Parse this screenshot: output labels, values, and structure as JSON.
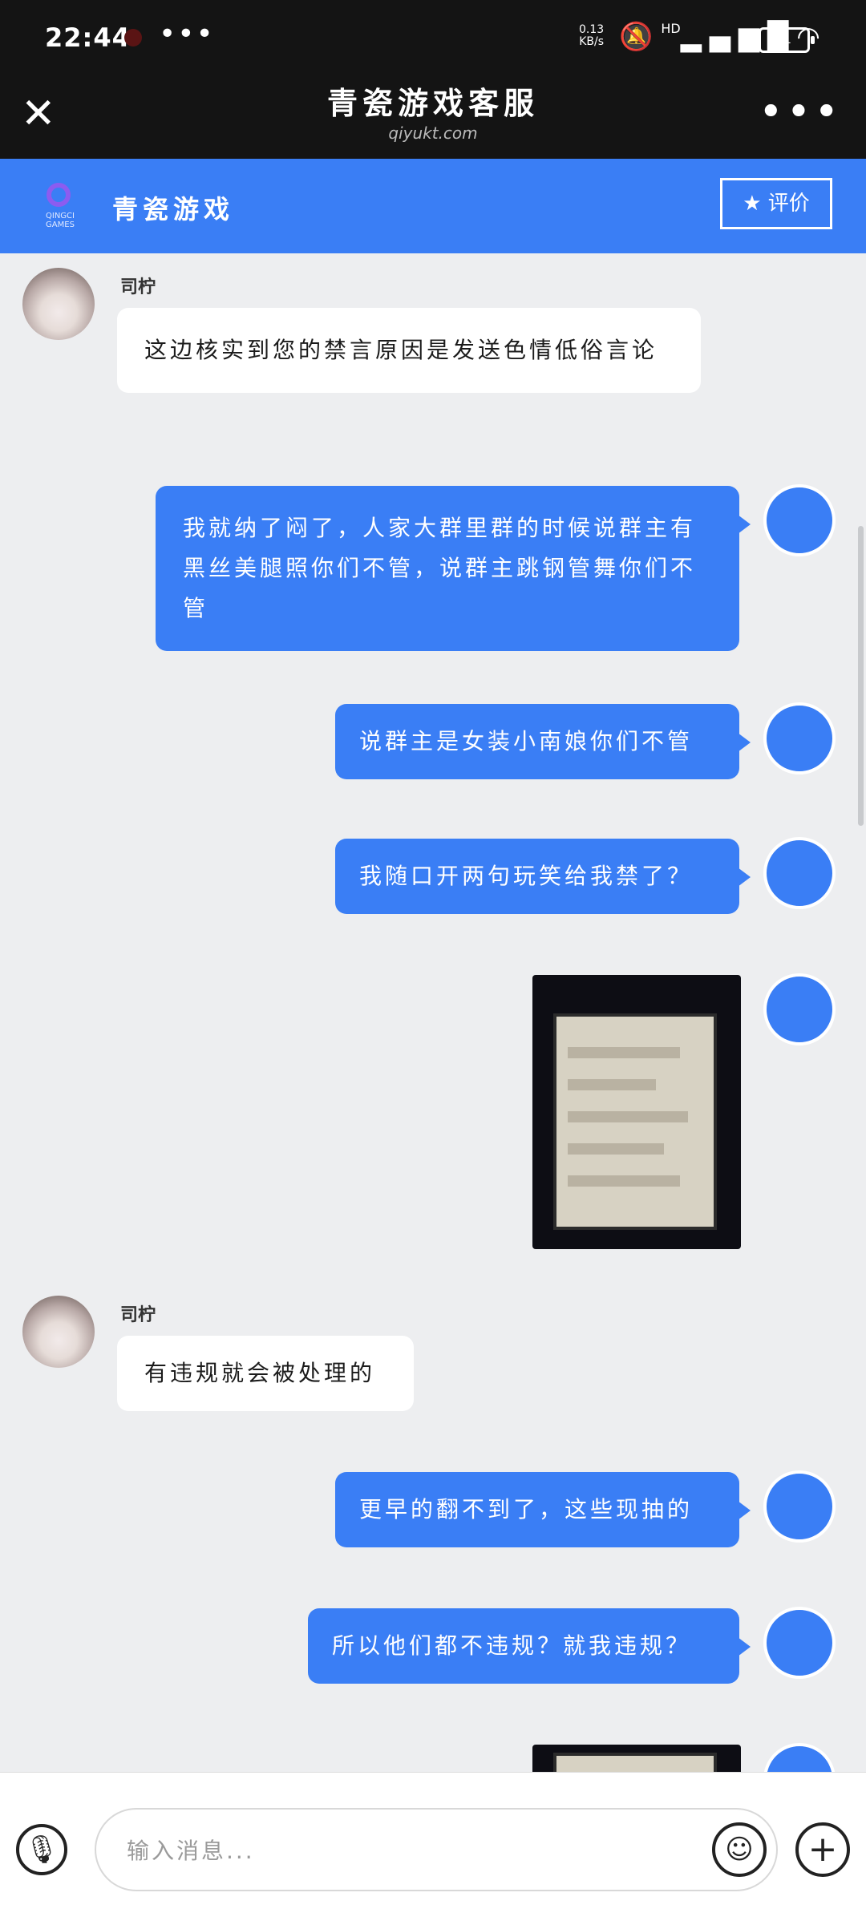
{
  "status_bar": {
    "time": "22:44",
    "more_glyph": "•••",
    "net_speed": "0.13\nKB/s",
    "network_label": "HD",
    "battery": "31"
  },
  "title_bar": {
    "close_glyph": "✕",
    "title": "青瓷游戏客服",
    "subtitle": "qiyukt.com",
    "more_glyph": "•••"
  },
  "brand_bar": {
    "logo_text": "QINGCI GAMES",
    "name": "青瓷游戏",
    "rate_label": "评价",
    "accent": "#3a7ef5"
  },
  "messages": [
    {
      "from": "agent",
      "sender": "司柠",
      "text": "这边核实到您的禁言原因是发送色情低俗言论"
    },
    {
      "from": "user",
      "text": "我就纳了闷了，人家大群里群的时候说群主有黑丝美腿照你们不管，说群主跳钢管舞你们不管"
    },
    {
      "from": "user",
      "text": "说群主是女装小南娘你们不管"
    },
    {
      "from": "user",
      "text": "我随口开两句玩笑给我禁了？"
    },
    {
      "from": "user",
      "type": "image"
    },
    {
      "from": "agent",
      "sender": "司柠",
      "text": "有违规就会被处理的"
    },
    {
      "from": "user",
      "text": "更早的翻不到了，这些现抽的"
    },
    {
      "from": "user",
      "text": "所以他们都不违规？就我违规？"
    },
    {
      "from": "user",
      "type": "image"
    }
  ],
  "input_bar": {
    "placeholder": "输入消息...",
    "voice_icon": "mic-icon",
    "emoji_icon": "emoji-icon",
    "add_icon": "plus-icon"
  }
}
